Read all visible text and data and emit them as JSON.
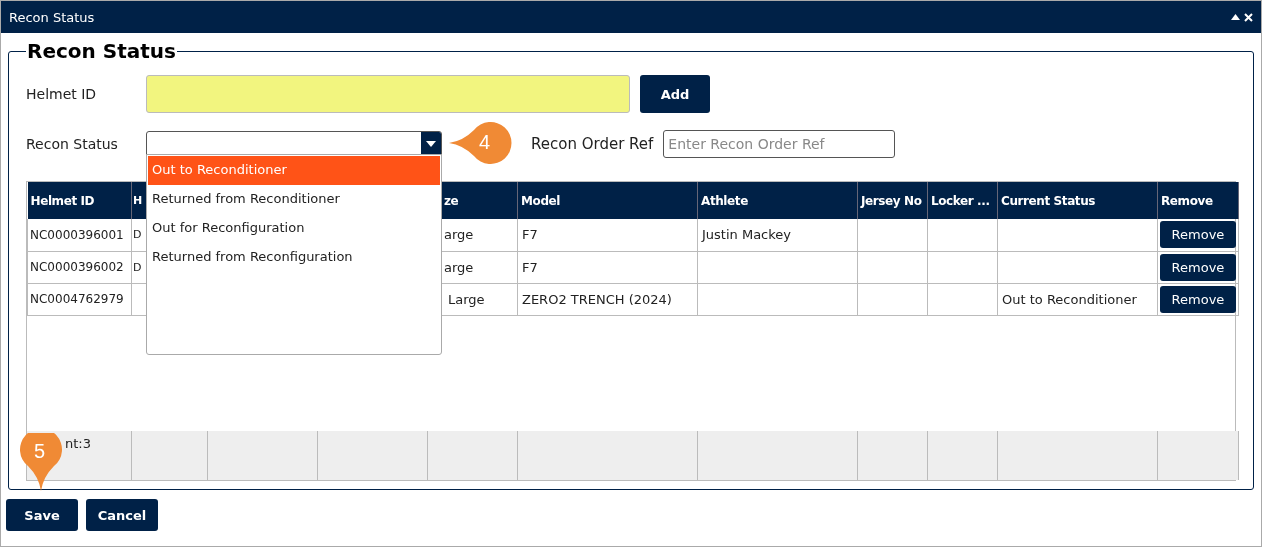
{
  "window": {
    "title": "Recon Status"
  },
  "form": {
    "legend": "Recon Status",
    "helmet_id": {
      "label": "Helmet ID",
      "add_button": "Add"
    },
    "recon_status": {
      "label": "Recon Status",
      "expanded": true,
      "options": [
        {
          "label": "Out to Reconditioner",
          "selected": true
        },
        {
          "label": "Returned from Reconditioner",
          "selected": false
        },
        {
          "label": "Out for Reconfiguration",
          "selected": false
        },
        {
          "label": "Returned from Reconfiguration",
          "selected": false
        }
      ]
    },
    "recon_order_ref": {
      "label": "Recon Order Ref",
      "placeholder": "Enter Recon Order Ref"
    }
  },
  "table": {
    "columns": [
      {
        "label": "Helmet ID"
      },
      {
        "label": "H"
      },
      {},
      {},
      {
        "label": "ze"
      },
      {
        "label": "Model"
      },
      {
        "label": "Athlete"
      },
      {
        "label": "Jersey No"
      },
      {
        "label": "Locker ..."
      },
      {
        "label": "Current Status"
      },
      {
        "label": "Remove"
      }
    ],
    "rows": [
      {
        "cells": [
          "NC0000396001",
          "D",
          null,
          null,
          "arge",
          "F7",
          "Justin Mackey",
          null,
          null,
          null
        ],
        "remove": "Remove"
      },
      {
        "cells": [
          "NC0000396002",
          "D",
          null,
          null,
          "arge",
          "F7",
          null,
          null,
          null,
          null
        ],
        "remove": "Remove"
      },
      {
        "cells": [
          "NC0004762979",
          null,
          null,
          null,
          "Large",
          "ZERO2 TRENCH (2024)",
          null,
          null,
          null,
          "Out to Reconditioner"
        ],
        "remove": "Remove"
      }
    ],
    "footer": "nt:3"
  },
  "markers": [
    {
      "label": "4",
      "kind": "side"
    },
    {
      "label": "5",
      "kind": "below"
    }
  ],
  "buttons": [
    {
      "label": "Save"
    },
    {
      "label": "Cancel"
    }
  ]
}
